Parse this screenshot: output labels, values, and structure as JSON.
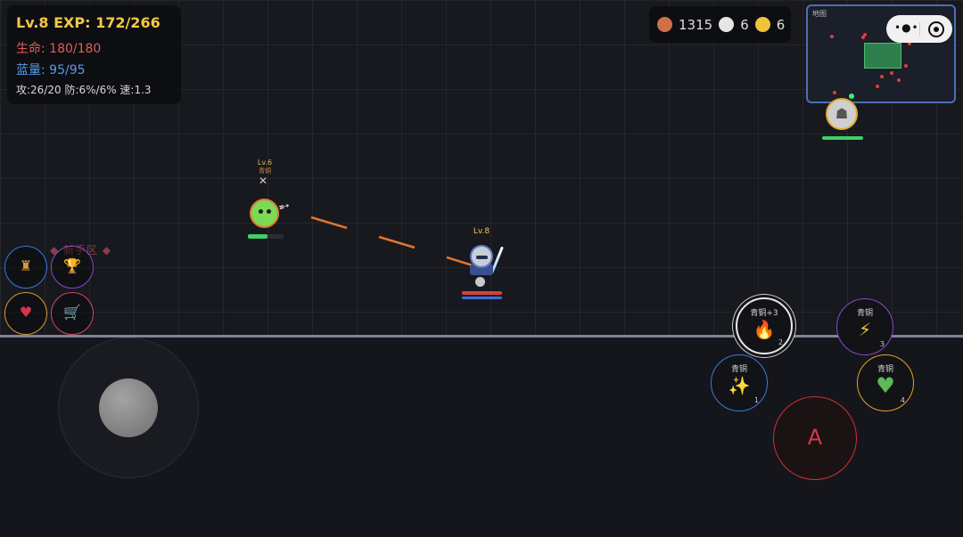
{
  "player_stats": {
    "level_exp": "Lv.8  EXP: 172/266",
    "hp": "生命: 180/180",
    "mp": "蓝量: 95/95",
    "attributes": "攻:26/20 防:6%/6% 速:1.3"
  },
  "currency": {
    "copper": "1315",
    "silver": "6",
    "gold": "6",
    "colors": {
      "copper": "#d0704a",
      "silver": "#e6e6e6",
      "gold": "#f2c23a"
    }
  },
  "minimap": {
    "label": "地图"
  },
  "enemy": {
    "level": "Lv.6",
    "tier": "青铜",
    "hp_fraction": 0.55
  },
  "player": {
    "level": "Lv.8",
    "hp_fraction": 1.0,
    "mp_fraction": 1.0
  },
  "side_menu": {
    "zone_label": "◆ 新手区 ◆",
    "buttons": [
      {
        "icon": "bag-icon",
        "glyph": "♜",
        "color": "#3d78d6"
      },
      {
        "icon": "trophy-icon",
        "glyph": "🏆",
        "color": "#8a47d1"
      },
      {
        "icon": "armor-icon",
        "glyph": "♥",
        "color": "#d99a2b"
      },
      {
        "icon": "shop-icon",
        "glyph": "🛒",
        "color": "#d8465a"
      }
    ]
  },
  "skills": [
    {
      "tier": "青铜",
      "key": "1",
      "icon": "sparkle-icon",
      "glyph": "✨"
    },
    {
      "tier": "青铜+3",
      "key": "2",
      "icon": "fire-icon",
      "glyph": "🔥"
    },
    {
      "tier": "青铜",
      "key": "3",
      "icon": "lightning-icon",
      "glyph": "⚡"
    },
    {
      "tier": "青铜",
      "key": "4",
      "icon": "heart-icon",
      "glyph": "♥"
    }
  ],
  "attack_button": {
    "label": "A"
  }
}
